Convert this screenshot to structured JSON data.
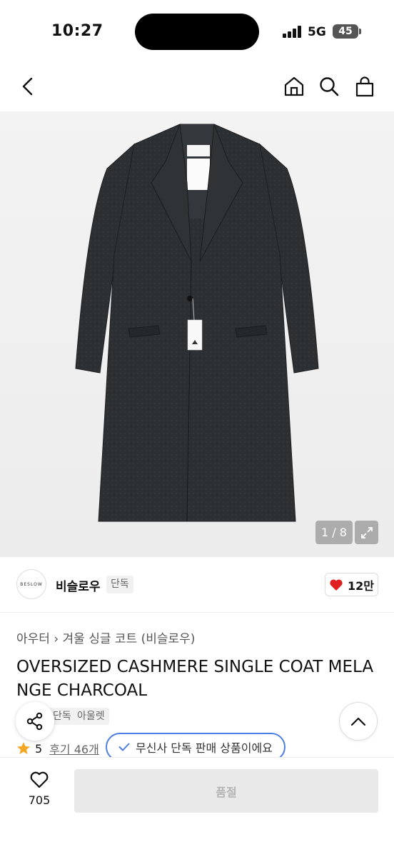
{
  "status_bar": {
    "time": "10:27",
    "network": "5G",
    "battery": "45"
  },
  "nav": {
    "icons": [
      "back-arrow-icon",
      "home-icon",
      "search-icon",
      "shopping-bag-icon"
    ]
  },
  "gallery": {
    "counter": "1 / 8",
    "expand_icon": "expand-icon"
  },
  "brand": {
    "logo_text": "BESLOW",
    "name": "비슬로우",
    "badge": "단독",
    "like_count": "12만"
  },
  "product": {
    "breadcrumb_category": "아우터",
    "breadcrumb_sub": "겨울 싱글 코트 (비슬로우)",
    "title": "OVERSIZED CASHMERE SINGLE COAT MELANGE CHARCOAL",
    "tags": [
      "단독",
      "아울렛"
    ]
  },
  "rating": {
    "score": "5",
    "reviews": "후기 46개"
  },
  "exclusive_badge": "무신사 단독 판매 상품이에요",
  "bottom_bar": {
    "wish_count": "705",
    "buy_label": "품절"
  },
  "colors": {
    "heart": "#e02020",
    "star": "#f5a623",
    "badge_border": "#4d7ee6"
  }
}
